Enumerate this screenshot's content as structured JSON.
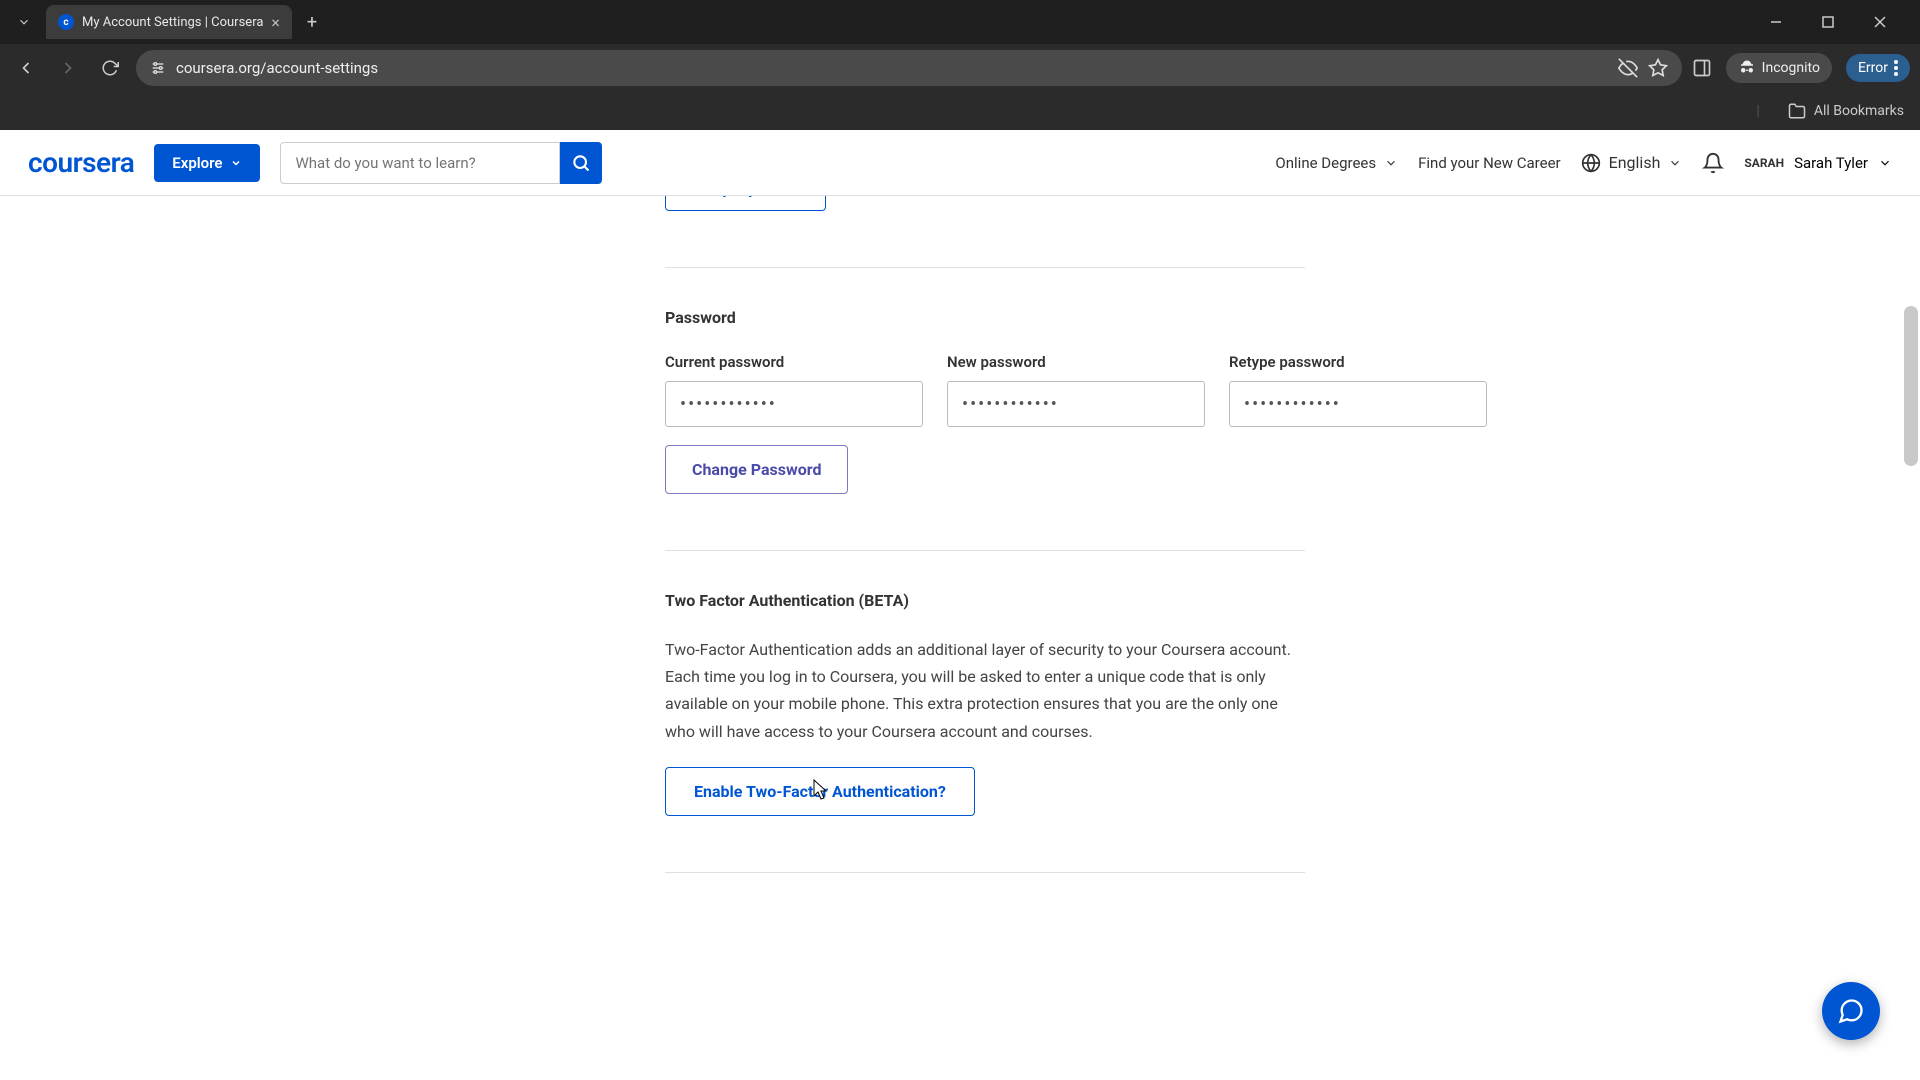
{
  "browser": {
    "tab_title": "My Account Settings | Coursera",
    "url": "coursera.org/account-settings",
    "incognito_label": "Incognito",
    "error_label": "Error",
    "bookmarks_label": "All Bookmarks"
  },
  "header": {
    "logo": "coursera",
    "explore": "Explore",
    "search_placeholder": "What do you want to learn?",
    "online_degrees": "Online Degrees",
    "find_career": "Find your New Career",
    "language": "English",
    "user_short": "SARAH",
    "user_name": "Sarah Tyler"
  },
  "content": {
    "verify_name": "Verify My Name",
    "password_section": "Password",
    "current_password_label": "Current password",
    "new_password_label": "New password",
    "retype_password_label": "Retype password",
    "current_password_value": "••••••••••••",
    "new_password_value": "••••••••••••",
    "retype_password_value": "••••••••••••",
    "change_password": "Change Password",
    "tfa_title": "Two Factor Authentication (BETA)",
    "tfa_desc": "Two-Factor Authentication adds an additional layer of security to your Coursera account. Each time you log in to Coursera, you will be asked to enter a unique code that is only available on your mobile phone. This extra protection ensures that you are the only one who will have access to your Coursera account and courses.",
    "tfa_button": "Enable Two-Factor Authentication?"
  }
}
